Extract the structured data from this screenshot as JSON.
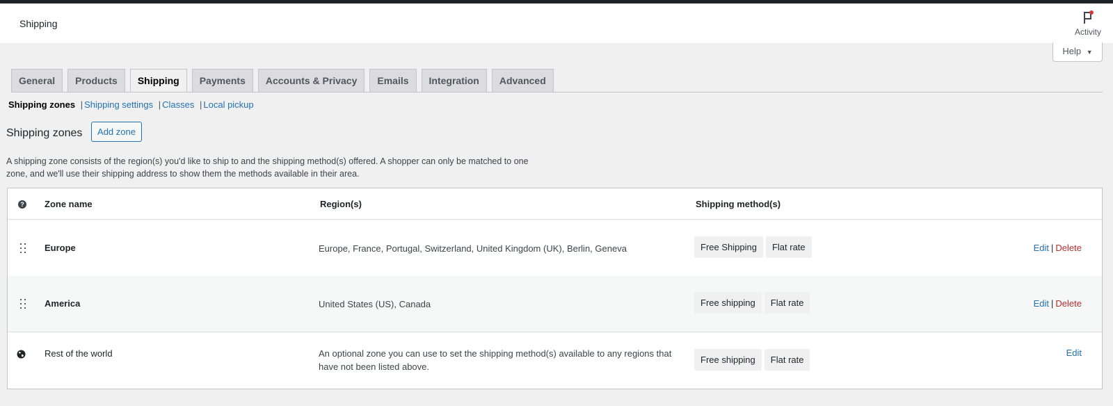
{
  "header": {
    "title": "Shipping",
    "activity_label": "Activity",
    "activity_icon": "flag-icon"
  },
  "help": {
    "label": "Help"
  },
  "tabs": [
    {
      "label": "General"
    },
    {
      "label": "Products"
    },
    {
      "label": "Shipping",
      "active": true
    },
    {
      "label": "Payments"
    },
    {
      "label": "Accounts & Privacy"
    },
    {
      "label": "Emails"
    },
    {
      "label": "Integration"
    },
    {
      "label": "Advanced"
    }
  ],
  "subnav": {
    "current": "Shipping zones",
    "links": [
      "Shipping settings",
      "Classes",
      "Local pickup"
    ]
  },
  "page": {
    "title": "Shipping zones",
    "add_button": "Add zone",
    "description": "A shipping zone consists of the region(s) you'd like to ship to and the shipping method(s) offered. A shopper can only be matched to one zone, and we'll use their shipping address to show them the methods available in their area."
  },
  "table": {
    "columns": {
      "zone": "Zone name",
      "regions": "Region(s)",
      "methods": "Shipping method(s)"
    },
    "rows": [
      {
        "zone": "Europe",
        "regions": "Europe, France, Portugal, Switzerland, United Kingdom (UK), Berlin, Geneva",
        "methods": [
          "Free Shipping",
          "Flat rate"
        ],
        "edit": "Edit",
        "delete": "Delete"
      },
      {
        "zone": "America",
        "regions": "United States (US), Canada",
        "methods": [
          "Free shipping",
          "Flat rate"
        ],
        "edit": "Edit",
        "delete": "Delete"
      },
      {
        "zone": "Rest of the world",
        "regions": "An optional zone you can use to set the shipping method(s) available to any regions that have not been listed above.",
        "methods": [
          "Free shipping",
          "Flat rate"
        ],
        "edit": "Edit"
      }
    ]
  },
  "colors": {
    "link": "#2271b1",
    "delete": "#b32d2e",
    "text": "#1d2327",
    "background": "#f0f0f1"
  }
}
